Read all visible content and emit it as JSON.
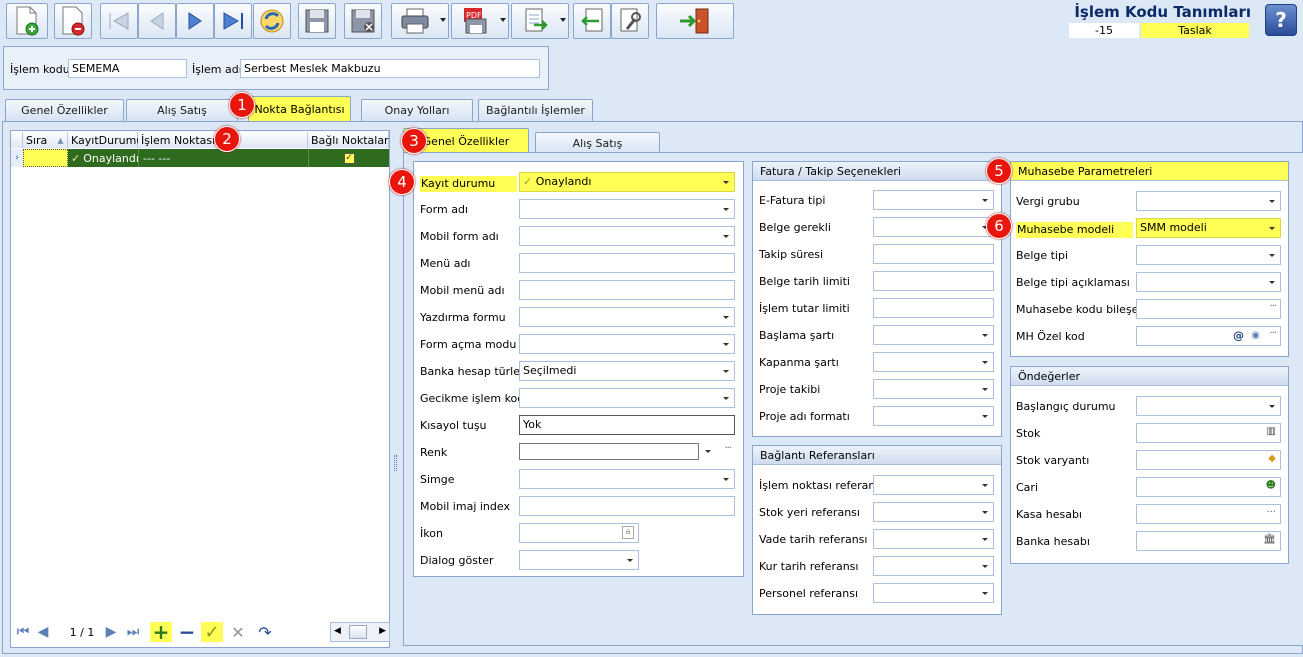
{
  "window": {
    "title": "İşlem Kodu Tanımları",
    "status_value": "-15",
    "status_text": "Taslak",
    "help_glyph": "?"
  },
  "toolbar": {
    "pdf_label": "PDF"
  },
  "header": {
    "code_label": "İşlem kodu",
    "code_value": "SEMEMA",
    "name_label": "İşlem adı",
    "name_value": "Serbest Meslek Makbuzu"
  },
  "main_tabs": [
    {
      "label": "Genel Özellikler"
    },
    {
      "label": "Alış Satış"
    },
    {
      "label": "Nokta Bağlantısı"
    },
    {
      "label": "Onay Yolları"
    },
    {
      "label": "Bağlantılı İşlemler"
    }
  ],
  "grid": {
    "columns": [
      "Sıra",
      "KayıtDurumu",
      "İşlem Noktası",
      "Bağlı Noktalar"
    ],
    "rows": [
      {
        "sira": "",
        "durum": "Onaylandı",
        "nokta": "--- ---",
        "bagli": true
      }
    ],
    "pager": "1 / 1"
  },
  "sub_tabs": [
    {
      "label": "Genel Özellikler"
    },
    {
      "label": "Alış Satış"
    }
  ],
  "genel": {
    "fields": [
      {
        "label": "Kayıt durumu",
        "value": "Onaylandı"
      },
      {
        "label": "Form adı",
        "value": ""
      },
      {
        "label": "Mobil form adı",
        "value": ""
      },
      {
        "label": "Menü adı",
        "value": ""
      },
      {
        "label": "Mobil menü adı",
        "value": ""
      },
      {
        "label": "Yazdırma formu",
        "value": ""
      },
      {
        "label": "Form açma modu",
        "value": ""
      },
      {
        "label": "Banka hesap türleri",
        "value": "Seçilmedi"
      },
      {
        "label": "Gecikme işlem kodu",
        "value": ""
      },
      {
        "label": "Kısayol tuşu",
        "value": "Yok"
      },
      {
        "label": "Renk",
        "value": ""
      },
      {
        "label": "Simge",
        "value": ""
      },
      {
        "label": "Mobil imaj index",
        "value": ""
      },
      {
        "label": "İkon",
        "value": ""
      },
      {
        "label": "Dialog göster",
        "value": ""
      }
    ]
  },
  "fatura": {
    "title": "Fatura / Takip Seçenekleri",
    "fields": [
      {
        "label": "E-Fatura tipi"
      },
      {
        "label": "Belge gerekli"
      },
      {
        "label": "Takip süresi"
      },
      {
        "label": "Belge tarih limiti"
      },
      {
        "label": "İşlem tutar limiti"
      },
      {
        "label": "Başlama şartı"
      },
      {
        "label": "Kapanma şartı"
      },
      {
        "label": "Proje takibi"
      },
      {
        "label": "Proje adı formatı"
      }
    ]
  },
  "baglanti": {
    "title": "Bağlantı Referansları",
    "fields": [
      {
        "label": "İşlem noktası referansı"
      },
      {
        "label": "Stok yeri referansı"
      },
      {
        "label": "Vade tarih referansı"
      },
      {
        "label": "Kur tarih referansı"
      },
      {
        "label": "Personel referansı"
      }
    ]
  },
  "muhasebe": {
    "title": "Muhasebe Parametreleri",
    "fields": [
      {
        "label": "Vergi grubu",
        "value": ""
      },
      {
        "label": "Muhasebe modeli",
        "value": "SMM modeli"
      },
      {
        "label": "Belge tipi",
        "value": ""
      },
      {
        "label": "Belge tipi açıklaması",
        "value": ""
      },
      {
        "label": "Muhasebe kodu bileşeni",
        "value": ""
      },
      {
        "label": "MH Özel kod",
        "value": ""
      }
    ]
  },
  "ondeger": {
    "title": "Öndeğerler",
    "fields": [
      {
        "label": "Başlangıç durumu"
      },
      {
        "label": "Stok"
      },
      {
        "label": "Stok varyantı"
      },
      {
        "label": "Cari"
      },
      {
        "label": "Kasa hesabı"
      },
      {
        "label": "Banka hesabı"
      }
    ]
  },
  "badges": [
    "1",
    "2",
    "3",
    "4",
    "5",
    "6"
  ],
  "colors": {
    "highlight": "#ffff55",
    "grid_row": "#2f6b1f",
    "badge": "#e8160c"
  }
}
